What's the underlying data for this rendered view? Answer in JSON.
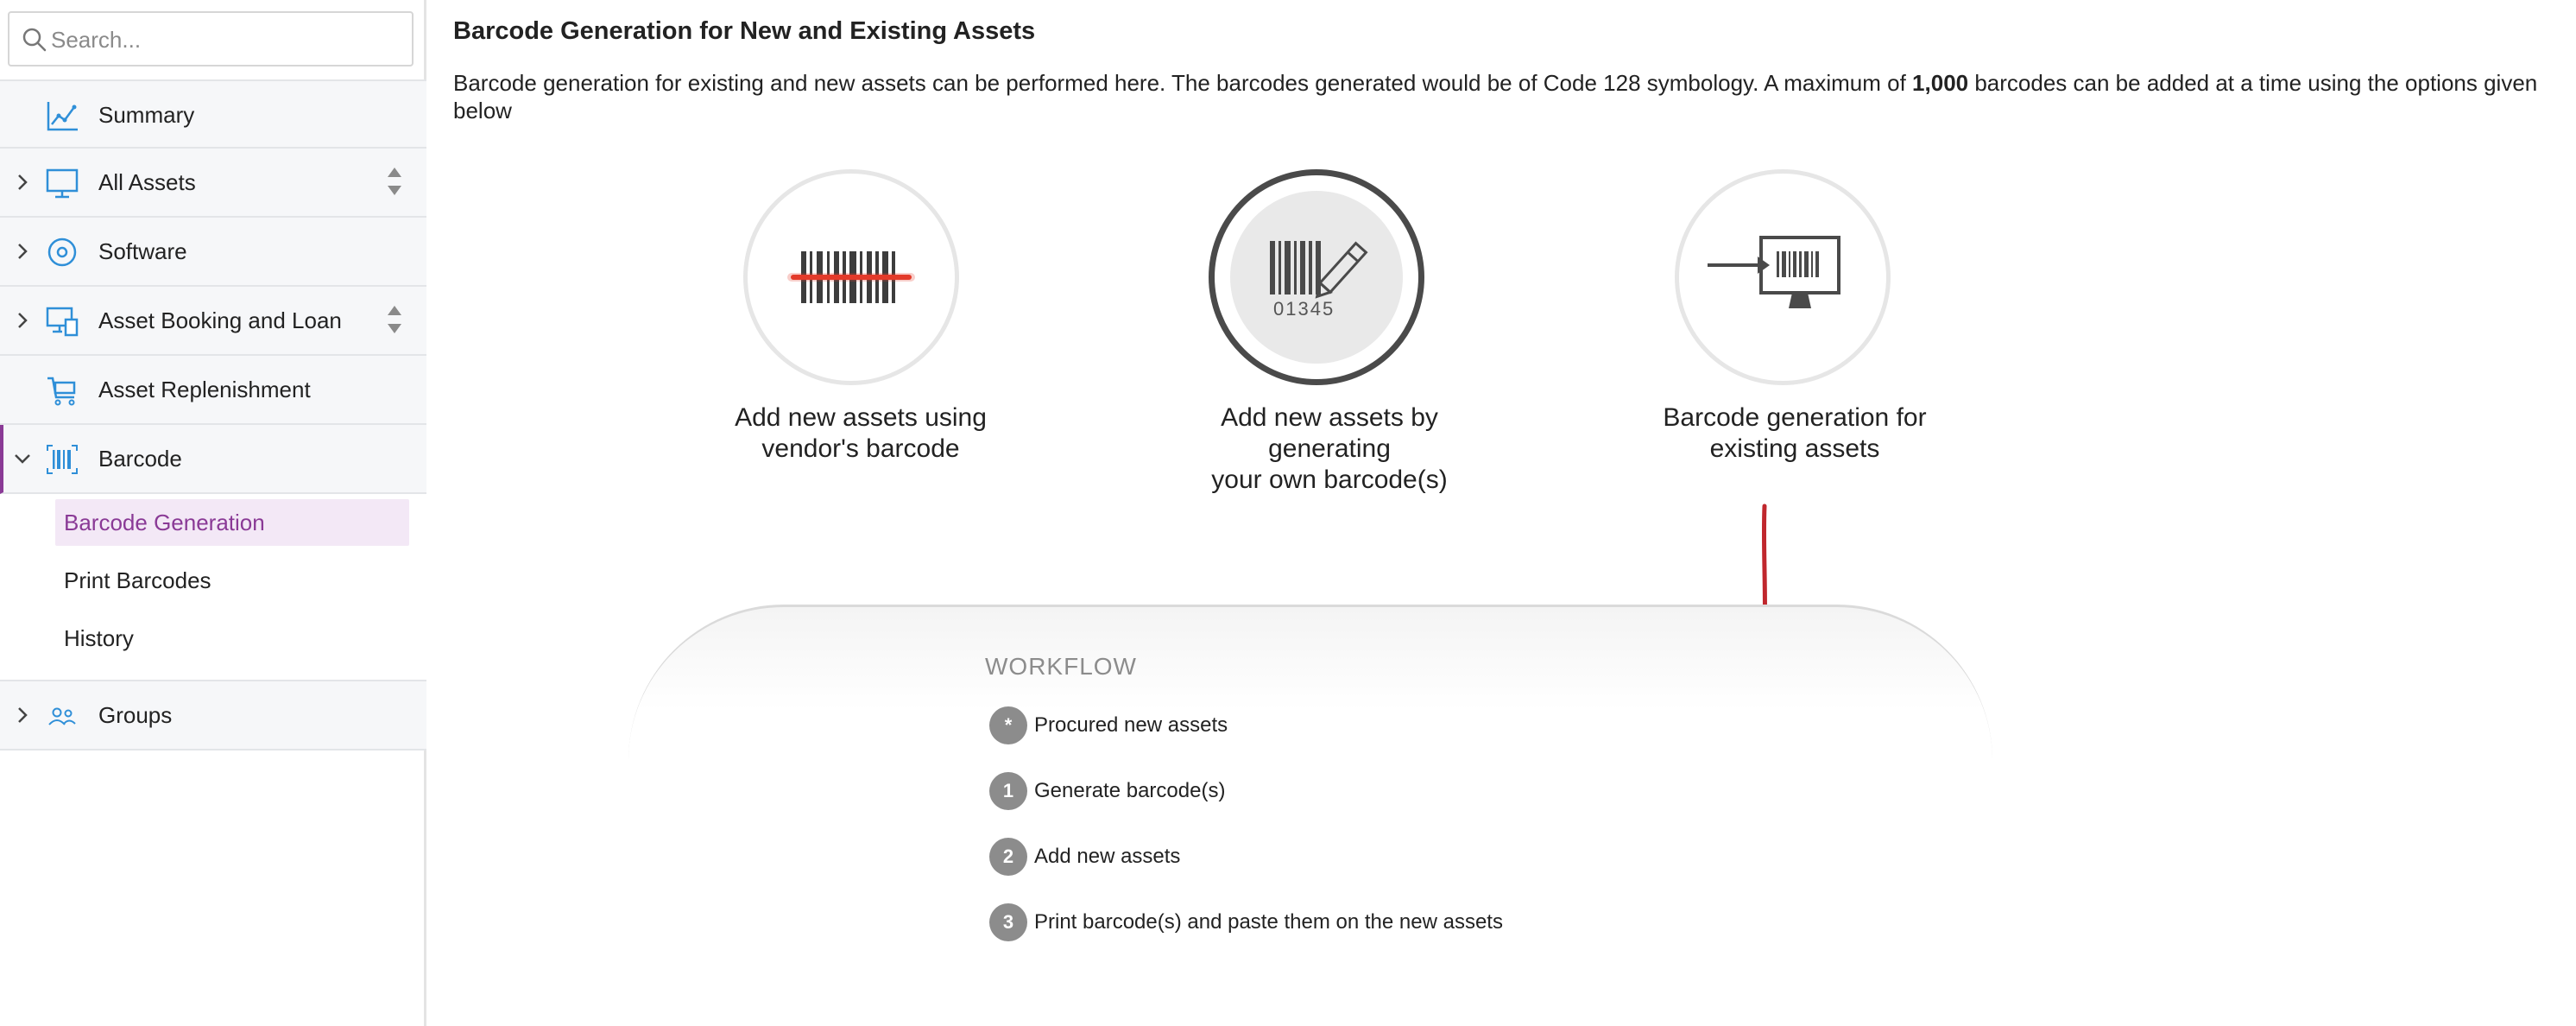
{
  "search": {
    "placeholder": "Search..."
  },
  "sidebar": {
    "items": [
      {
        "label": "Summary",
        "icon": "summary-chart-icon"
      },
      {
        "label": "All Assets",
        "icon": "monitor-icon"
      },
      {
        "label": "Software",
        "icon": "disc-icon"
      },
      {
        "label": "Asset Booking and Loan",
        "icon": "asset-booking-icon"
      },
      {
        "label": "Asset Replenishment",
        "icon": "cart-icon"
      },
      {
        "label": "Barcode",
        "icon": "barcode-icon"
      },
      {
        "label": "Groups",
        "icon": "users-icon"
      }
    ],
    "barcode_subitems": [
      {
        "label": "Barcode Generation",
        "active": true
      },
      {
        "label": "Print Barcodes",
        "active": false
      },
      {
        "label": "History",
        "active": false
      }
    ]
  },
  "main": {
    "title": "Barcode Generation for New and Existing Assets",
    "description_part1": "Barcode generation for existing and new assets can be performed here. The barcodes generated would be of Code 128 symbology. A maximum of ",
    "description_bold": "1,000",
    "description_part2": " barcodes can be added at a time using the options given below",
    "options": [
      {
        "line1": "Add new assets using",
        "line2": "vendor's barcode",
        "line3": "",
        "icon": "barcode-scan-icon"
      },
      {
        "line1": "Add new assets by",
        "line2": "generating",
        "line3": "your own barcode(s)",
        "icon": "barcode-generate-icon",
        "barcode_number": "01345",
        "selected": true
      },
      {
        "line1": "Barcode generation for",
        "line2": "existing assets",
        "line3": "",
        "icon": "barcode-existing-icon"
      }
    ],
    "workflow": {
      "title": "WORKFLOW",
      "steps": [
        {
          "badge": "*",
          "text": "Procured new assets"
        },
        {
          "badge": "1",
          "text": "Generate barcode(s)"
        },
        {
          "badge": "2",
          "text": "Add new assets"
        },
        {
          "badge": "3",
          "text": "Print barcode(s) and paste them on the new assets"
        }
      ]
    }
  },
  "colors": {
    "accent": "#8a3a96",
    "active_bg": "#f3e8f6",
    "icon_blue": "#2f8fd8",
    "red_line": "#e33a2a",
    "arrow_red": "#c0272d",
    "badge_gray": "#8c8c8c"
  }
}
